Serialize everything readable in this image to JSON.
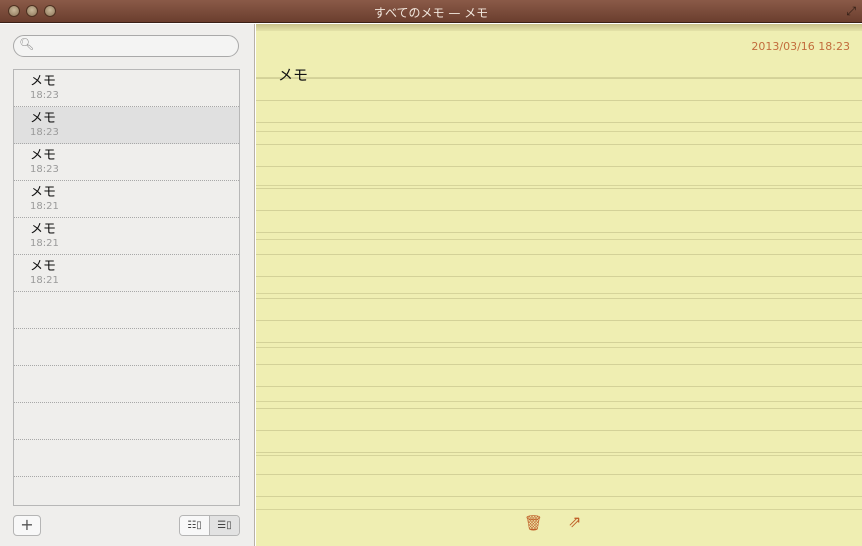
{
  "window": {
    "title": "すべてのメモ — メモ"
  },
  "sidebar": {
    "search_placeholder": "",
    "notes": [
      {
        "title": "メモ",
        "time": "18:23",
        "selected": false
      },
      {
        "title": "メモ",
        "time": "18:23",
        "selected": true
      },
      {
        "title": "メモ",
        "time": "18:23",
        "selected": false
      },
      {
        "title": "メモ",
        "time": "18:21",
        "selected": false
      },
      {
        "title": "メモ",
        "time": "18:21",
        "selected": false
      },
      {
        "title": "メモ",
        "time": "18:21",
        "selected": false
      }
    ],
    "add_label": "+"
  },
  "note": {
    "date": "2013/03/16 18:23",
    "body": "メモ"
  }
}
